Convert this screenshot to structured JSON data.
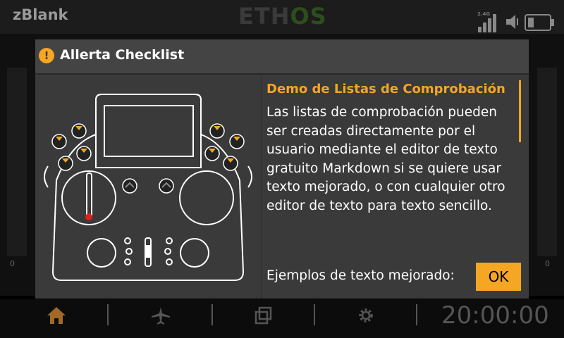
{
  "topbar": {
    "model_name": "zBlank",
    "logo_part1": "ETH",
    "logo_part2": "OS",
    "signal_label": "2.4G"
  },
  "sides": {
    "left_zero": "0",
    "right_zero": "0"
  },
  "dialog": {
    "title": "Allerta Checklist",
    "heading": "Demo de Listas de Comprobación",
    "body": "Las listas de comprobación pueden ser creadas directamente por el usuario mediante el editor de texto gratuito Markdown si se quiere usar texto mejorado, o con cualquier otro editor de texto para texto sencillo.",
    "body2": "Ejemplos de texto mejorado:",
    "ok_label": "OK"
  },
  "bottombar": {
    "timer": "20:00:00"
  },
  "colors": {
    "accent": "#f5a623",
    "dialog_bg": "#3a3a3a",
    "header_bg": "#444444"
  },
  "icons": [
    "warning-icon",
    "signal-icon",
    "volume-icon",
    "battery-icon",
    "home-icon",
    "airplane-icon",
    "layers-icon",
    "gear-icon"
  ]
}
